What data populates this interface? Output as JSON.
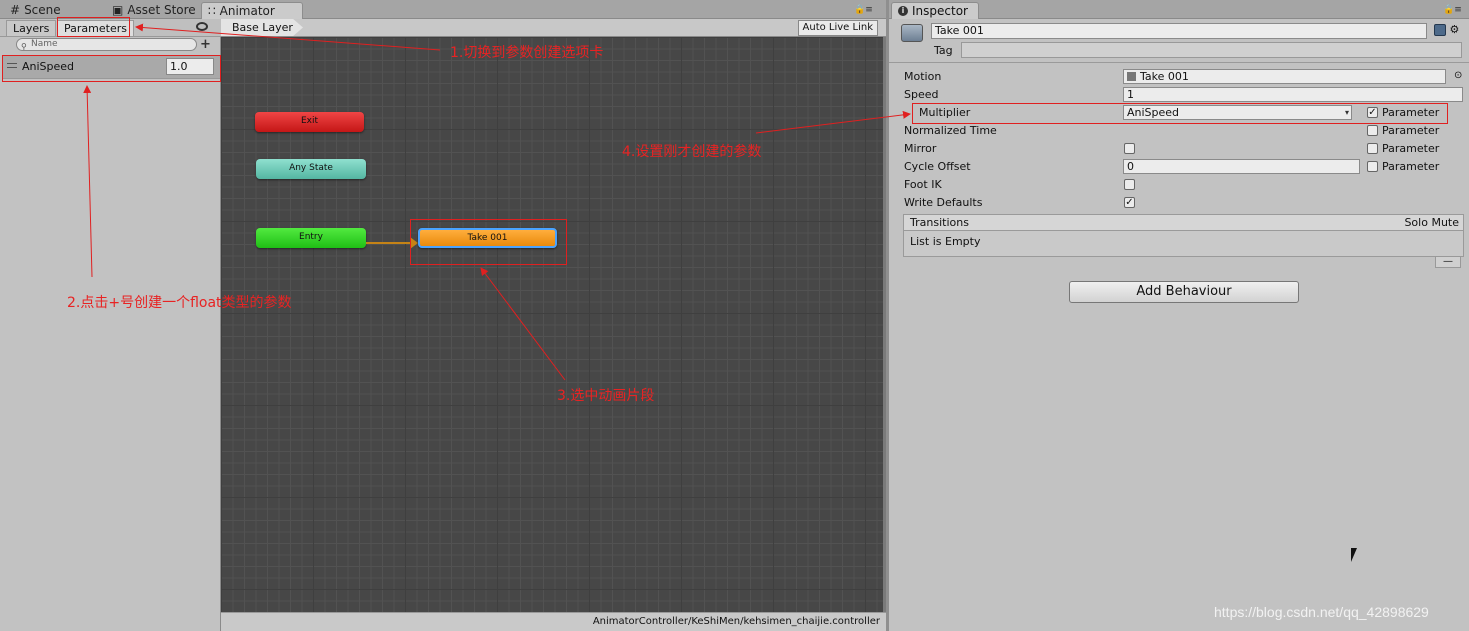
{
  "tabs": {
    "scene": "Scene",
    "asset_store": "Asset Store",
    "animator": "Animator"
  },
  "animator": {
    "subtabs": {
      "layers": "Layers",
      "parameters": "Parameters"
    },
    "search_placeholder": "Name",
    "parameter": {
      "name": "AniSpeed",
      "value": "1.0"
    },
    "breadcrumb": "Base Layer",
    "auto_live_link": "Auto Live Link",
    "nodes": {
      "exit": "Exit",
      "any_state": "Any State",
      "entry": "Entry",
      "take": "Take 001"
    },
    "status_path": "AnimatorController/KeShiMen/kehsimen_chaijie.controller",
    "node_colors": {
      "exit": "#d92a2a",
      "any_state": "#6fcab8",
      "entry": "#35d32a",
      "take": "#f59a1c"
    }
  },
  "inspector": {
    "tab": "Inspector",
    "name": "Take 001",
    "tag_label": "Tag",
    "motion_label": "Motion",
    "motion_value": "Take 001",
    "speed_label": "Speed",
    "speed_value": "1",
    "multiplier_label": "Multiplier",
    "multiplier_value": "AniSpeed",
    "parameter_label": "Parameter",
    "normalized_time_label": "Normalized Time",
    "mirror_label": "Mirror",
    "cycle_offset_label": "Cycle Offset",
    "cycle_offset_value": "0",
    "foot_ik_label": "Foot IK",
    "write_defaults_label": "Write Defaults",
    "transitions_label": "Transitions",
    "solo_mute_label": "Solo Mute",
    "list_empty": "List is Empty",
    "add_behaviour": "Add Behaviour",
    "checks": {
      "multiplier_parameter": true,
      "write_defaults": true
    }
  },
  "annotations": {
    "step1": "1.切换到参数创建选项卡",
    "step2": "2.点击+号创建一个float类型的参数",
    "step3": "3.选中动画片段",
    "step4": "4.设置刚才创建的参数",
    "color": "#e02020"
  },
  "watermark": "https://blog.csdn.net/qq_42898629"
}
